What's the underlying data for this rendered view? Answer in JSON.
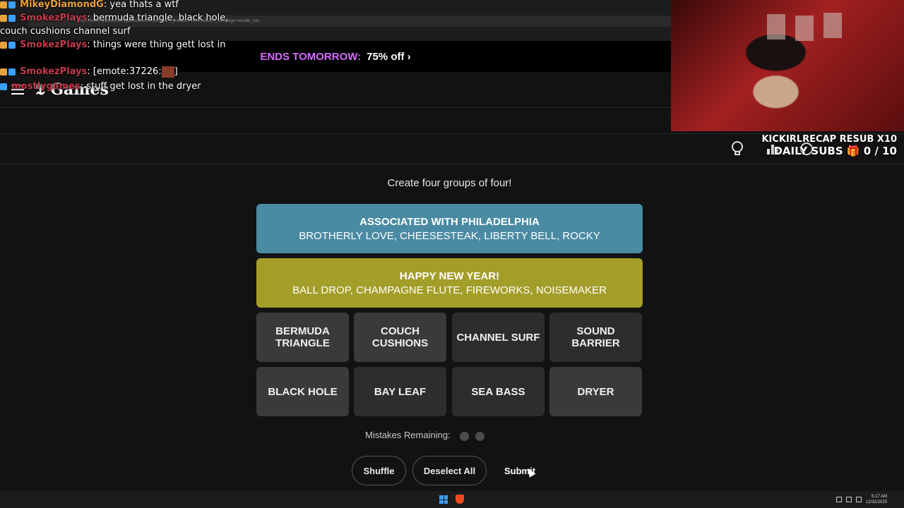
{
  "browser": {
    "url": "https://www.nytimes.com/games/connections?utm_medium=referral&utm_campaign=wordle_nav"
  },
  "promo": {
    "ends_label": "ENDS TOMORROW:",
    "offer_label": "75% off ›"
  },
  "site": {
    "logo": "Games"
  },
  "chat": {
    "messages": [
      {
        "user": "MikeyDiamondG",
        "text": ": yea thats a wtf"
      },
      {
        "user": "SmokezPlays",
        "text": ": bermuda triangle, black hole, couch cushions channel surf"
      },
      {
        "user": "SmokezPlays",
        "text": ": things were thing gett lost in"
      },
      {
        "user": "SmokezPlays",
        "text": ": [emote:37226:",
        "suffix": "]"
      },
      {
        "user": "mostlygames",
        "text": ": stuff get lost in the dryer"
      }
    ]
  },
  "stream_overlay": {
    "line1": "KICKIRLRECAP RESUB X10",
    "line2": "DAILY SUBS 🎁 0 / 10"
  },
  "game": {
    "instructions": "Create four groups of four!",
    "solved_groups": [
      {
        "category": "ASSOCIATED WITH PHILADELPHIA",
        "words": "BROTHERLY LOVE, CHEESESTEAK, LIBERTY BELL, ROCKY",
        "color": "#4a8ba3"
      },
      {
        "category": "HAPPY NEW YEAR!",
        "words": "BALL DROP, CHAMPAGNE FLUTE, FIREWORKS, NOISEMAKER",
        "color": "#a39e29"
      }
    ],
    "tiles": [
      {
        "label": "BERMUDA TRIANGLE",
        "selected": true
      },
      {
        "label": "COUCH CUSHIONS",
        "selected": true
      },
      {
        "label": "CHANNEL SURF",
        "selected": false
      },
      {
        "label": "SOUND BARRIER",
        "selected": false
      },
      {
        "label": "BLACK HOLE",
        "selected": true
      },
      {
        "label": "BAY LEAF",
        "selected": false
      },
      {
        "label": "SEA BASS",
        "selected": false
      },
      {
        "label": "DRYER",
        "selected": true
      }
    ],
    "mistakes_label": "Mistakes Remaining:",
    "mistakes_remaining": 2,
    "buttons": {
      "shuffle": "Shuffle",
      "deselect": "Deselect All",
      "submit": "Submit"
    }
  },
  "taskbar": {
    "time": "5:17 AM",
    "date": "12/31/2025"
  }
}
